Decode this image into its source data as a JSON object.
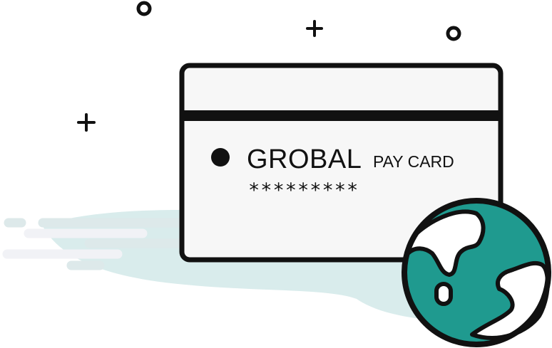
{
  "card": {
    "brand": "GROBAL",
    "subtitle": "PAY CARD",
    "number": "*********"
  },
  "colors": {
    "outline": "#111111",
    "card_fill": "#f7f7f7",
    "globe_ocean": "#1f9a8f",
    "background_blob": "#d9ecec",
    "speed_lines": "#f1f2f6"
  },
  "icons": [
    "globe-icon",
    "plus-icon",
    "circle-icon",
    "card-dot-icon"
  ]
}
